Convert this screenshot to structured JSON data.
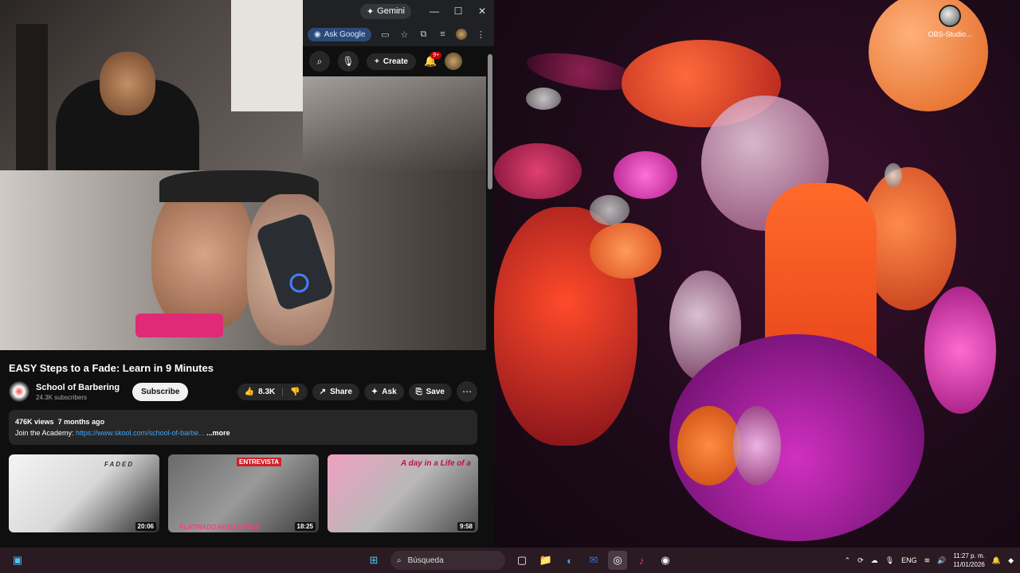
{
  "desktop": {
    "icon_label": "OBS-Studio..."
  },
  "browser": {
    "gemini_label": "Gemini",
    "ask_google_label": "Ask Google"
  },
  "youtube": {
    "create_label": "Create",
    "notif_count": "9+",
    "video": {
      "title": "EASY Steps to a Fade: Learn in 9 Minutes",
      "channel": "School of Barbering",
      "subscribers": "24.3K subscribers",
      "subscribe_label": "Subscribe",
      "likes": "8.3K",
      "share_label": "Share",
      "ask_label": "Ask",
      "save_label": "Save",
      "views": "476K views",
      "age": "7 months ago",
      "desc_prefix": "Join the Academy: ",
      "desc_link": "https://www.skool.com/school-of-barbe...",
      "more_label": "...more"
    },
    "related": [
      {
        "duration": "20:06",
        "caption": "FADED"
      },
      {
        "duration": "18:25",
        "caption": "PLATINADO PASO A PASO",
        "badge": "ENTREVISTA"
      },
      {
        "duration": "9:58",
        "caption": "A day in a Life of a"
      }
    ]
  },
  "taskbar": {
    "search_placeholder": "Búsqueda",
    "lang": "ENG",
    "time": "11:27 p. m.",
    "date": "11/01/2026"
  }
}
